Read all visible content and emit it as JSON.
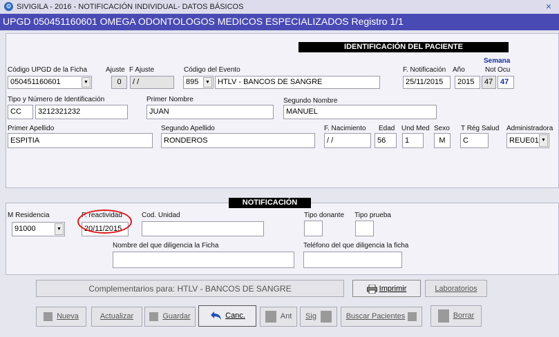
{
  "window": {
    "title": "SIVIGILA - 2016 -  NOTIFICACIÓN INDIVIDUAL- DATOS BÁSICOS",
    "close_glyph": "×"
  },
  "header": {
    "text": "UPGD 050451160601 OMEGA ODONTOLOGOS MEDICOS ESPECIALIZADOS Registro 1/1"
  },
  "patient": {
    "banner": "IDENTIFICACIÓN DEL PACIENTE",
    "upgd_label": "Código UPGD de la Ficha",
    "upgd_value": "050451160601",
    "ajuste_label": "Ajuste",
    "ajuste_value": "0",
    "fajuste_label": "F Ajuste",
    "fajuste_value": "/ /",
    "evento_label": "Código del Evento",
    "evento_code": "895",
    "evento_name": "HTLV - BANCOS DE SANGRE",
    "fnotif_label": "F. Notificación",
    "fnotif_value": "25/11/2015",
    "anio_label": "Año",
    "anio_value": "2015",
    "semana_label": "Semana",
    "not_label": "Not",
    "ocu_label": "Ocu",
    "not_value": "47",
    "ocu_value": "47",
    "tipo_id_label": "Tipo y Número de Identificación",
    "tipo_id_value": "CC",
    "num_id_value": "3212321232",
    "primer_nombre_label": "Primer Nombre",
    "primer_nombre_value": "JUAN",
    "segundo_nombre_label": "Segundo Nombre",
    "segundo_nombre_value": "MANUEL",
    "primer_apellido_label": "Primer Apellido",
    "primer_apellido_value": "ESPITIA",
    "segundo_apellido_label": "Segundo Apellido",
    "segundo_apellido_value": "RONDEROS",
    "fnac_label": "F. Nacimiento",
    "fnac_value": "/ /",
    "edad_label": "Edad",
    "edad_value": "56",
    "undmed_label": "Und Med",
    "undmed_value": "1",
    "sexo_label": "Sexo",
    "sexo_value": "M",
    "treg_label": "T Rég Salud",
    "treg_value": "C",
    "admin_label": "Administradora",
    "admin_value": "REUE01"
  },
  "notification": {
    "banner": "NOTIFICACIÓN",
    "mres_label": "M Residencia",
    "mres_value": "91000",
    "freact_label": "F. reactividad",
    "freact_value": "20/11/2015",
    "cod_unidad_label": "Cod. Unidad",
    "tipo_donante_label": "Tipo donante",
    "tipo_prueba_label": "Tipo prueba",
    "nombre_diligencia_label": "Nombre del que diligencia la Ficha",
    "telefono_label": "Teléfono del que diligencia la ficha"
  },
  "actions": {
    "complementarios": "Complementarios para: HTLV - BANCOS DE SANGRE",
    "imprimir": "Imprimir",
    "laboratorios": "Laboratorios",
    "nueva": "Nueva",
    "actualizar": "Actualizar",
    "guardar": "Guardar",
    "canc": "Canc.",
    "ant": "Ant",
    "sig": "Sig",
    "buscar": "Buscar Pacientes",
    "borrar": "Borrar"
  },
  "colors": {
    "header_bg": "#4a4ab4",
    "highlight_circle": "#e01818",
    "semana_blue": "#1a2fa0"
  },
  "icons": [
    "window-app-icon",
    "close-icon",
    "dropdown-arrow-icon",
    "printer-icon",
    "undo-arrow-icon"
  ]
}
